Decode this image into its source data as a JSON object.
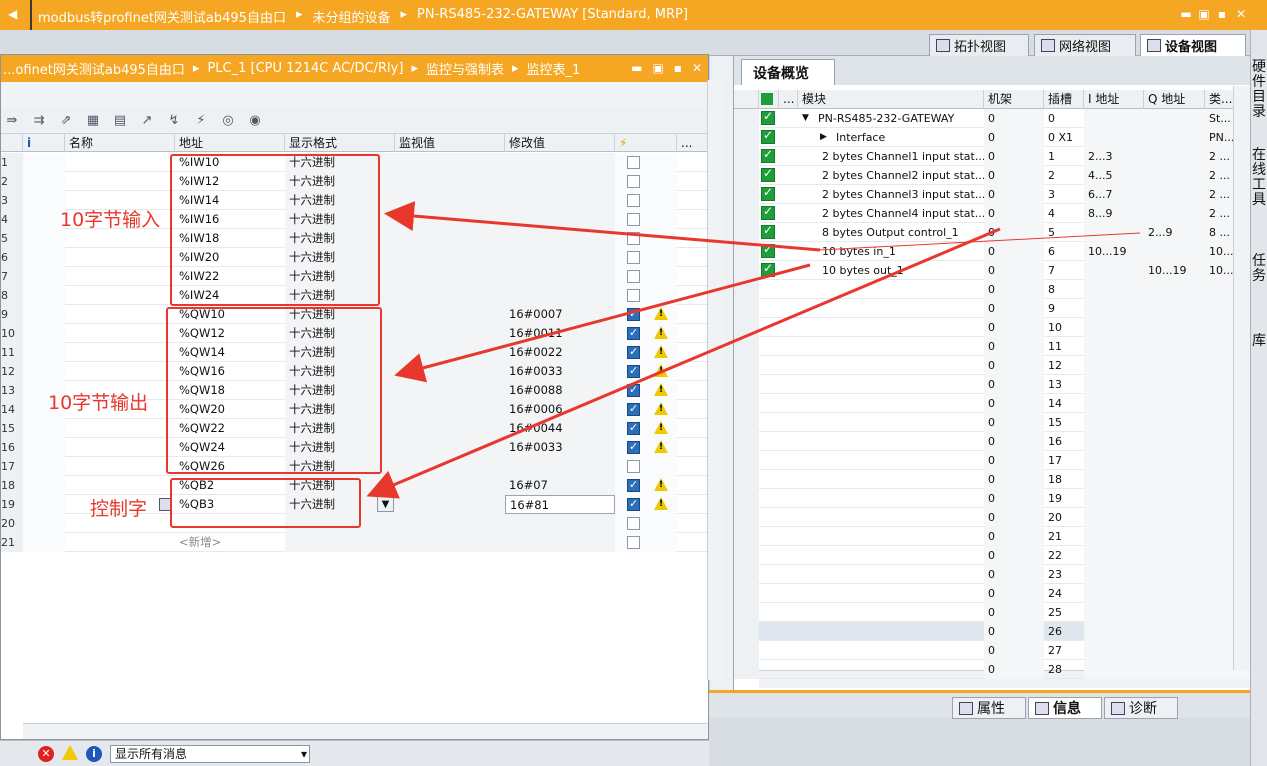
{
  "titlebar": {
    "crumbs": [
      "modbus转profinet网关测试ab495自由口",
      "未分组的设备",
      "PN-RS485-232-GATEWAY [Standard, MRP]"
    ],
    "controls": [
      "▬",
      "▣",
      "▪",
      "✕"
    ]
  },
  "view_tabs": [
    "拓扑视图",
    "网络视图",
    "设备视图"
  ],
  "left_panel": {
    "crumbs": [
      "...ofinet网关测试ab495自由口",
      "PLC_1 [CPU 1214C AC/DC/Rly]",
      "监控与强制表",
      "监控表_1"
    ],
    "controls": [
      "▬",
      "▣",
      "▪",
      "✕"
    ],
    "columns": [
      "i",
      "名称",
      "地址",
      "显示格式",
      "监视值",
      "修改值",
      "⚡",
      "..."
    ],
    "rows": [
      {
        "n": "1",
        "addr": "%IW10",
        "fmt": "十六进制",
        "mod": "",
        "check": false,
        "warn": false
      },
      {
        "n": "2",
        "addr": "%IW12",
        "fmt": "十六进制",
        "mod": "",
        "check": false,
        "warn": false
      },
      {
        "n": "3",
        "addr": "%IW14",
        "fmt": "十六进制",
        "mod": "",
        "check": false,
        "warn": false
      },
      {
        "n": "4",
        "addr": "%IW16",
        "fmt": "十六进制",
        "mod": "",
        "check": false,
        "warn": false
      },
      {
        "n": "5",
        "addr": "%IW18",
        "fmt": "十六进制",
        "mod": "",
        "check": false,
        "warn": false
      },
      {
        "n": "6",
        "addr": "%IW20",
        "fmt": "十六进制",
        "mod": "",
        "check": false,
        "warn": false
      },
      {
        "n": "7",
        "addr": "%IW22",
        "fmt": "十六进制",
        "mod": "",
        "check": false,
        "warn": false
      },
      {
        "n": "8",
        "addr": "%IW24",
        "fmt": "十六进制",
        "mod": "",
        "check": false,
        "warn": false
      },
      {
        "n": "9",
        "addr": "%QW10",
        "fmt": "十六进制",
        "mod": "16#0007",
        "check": true,
        "warn": true
      },
      {
        "n": "10",
        "addr": "%QW12",
        "fmt": "十六进制",
        "mod": "16#0011",
        "check": true,
        "warn": true
      },
      {
        "n": "11",
        "addr": "%QW14",
        "fmt": "十六进制",
        "mod": "16#0022",
        "check": true,
        "warn": true
      },
      {
        "n": "12",
        "addr": "%QW16",
        "fmt": "十六进制",
        "mod": "16#0033",
        "check": true,
        "warn": true
      },
      {
        "n": "13",
        "addr": "%QW18",
        "fmt": "十六进制",
        "mod": "16#0088",
        "check": true,
        "warn": true
      },
      {
        "n": "14",
        "addr": "%QW20",
        "fmt": "十六进制",
        "mod": "16#0006",
        "check": true,
        "warn": true
      },
      {
        "n": "15",
        "addr": "%QW22",
        "fmt": "十六进制",
        "mod": "16#0044",
        "check": true,
        "warn": true
      },
      {
        "n": "16",
        "addr": "%QW24",
        "fmt": "十六进制",
        "mod": "16#0033",
        "check": true,
        "warn": true
      },
      {
        "n": "17",
        "addr": "%QW26",
        "fmt": "十六进制",
        "mod": "",
        "check": false,
        "warn": false
      },
      {
        "n": "18",
        "addr": "%QB2",
        "fmt": "十六进制",
        "mod": "16#07",
        "check": true,
        "warn": true
      },
      {
        "n": "19",
        "addr": "%QB3",
        "fmt": "十六进制",
        "mod": "16#81",
        "check": true,
        "warn": true
      },
      {
        "n": "20",
        "addr": "",
        "fmt": "",
        "mod": "",
        "check": false,
        "warn": false
      },
      {
        "n": "21",
        "addr": "<新增>",
        "fmt": "",
        "mod": "",
        "check": false,
        "warn": false
      }
    ],
    "annotations": {
      "input": "10字节输入",
      "output": "10字节输出",
      "control": "控制字"
    }
  },
  "device_overview": {
    "tab": "设备概览",
    "columns": [
      "",
      "...",
      "模块",
      "机架",
      "插槽",
      "I 地址",
      "Q 地址",
      "类..."
    ],
    "rows": [
      {
        "name": "PN-RS485-232-GATEWAY",
        "rack": "0",
        "slot": "0",
        "i": "",
        "q": "",
        "type": "St...",
        "ok": true,
        "expand": "▼",
        "indent": 0
      },
      {
        "name": "Interface",
        "rack": "0",
        "slot": "0 X1",
        "i": "",
        "q": "",
        "type": "PN...",
        "ok": true,
        "expand": "▶",
        "indent": 1
      },
      {
        "name": "2 bytes Channel1 input stat...",
        "rack": "0",
        "slot": "1",
        "i": "2...3",
        "q": "",
        "type": "2 ...",
        "ok": true,
        "expand": "",
        "indent": 1
      },
      {
        "name": "2 bytes Channel2 input stat...",
        "rack": "0",
        "slot": "2",
        "i": "4...5",
        "q": "",
        "type": "2 ...",
        "ok": true,
        "expand": "",
        "indent": 1
      },
      {
        "name": "2 bytes Channel3 input stat...",
        "rack": "0",
        "slot": "3",
        "i": "6...7",
        "q": "",
        "type": "2 ...",
        "ok": true,
        "expand": "",
        "indent": 1
      },
      {
        "name": "2 bytes Channel4 input stat...",
        "rack": "0",
        "slot": "4",
        "i": "8...9",
        "q": "",
        "type": "2 ...",
        "ok": true,
        "expand": "",
        "indent": 1
      },
      {
        "name": "8 bytes Output control_1",
        "rack": "0",
        "slot": "5",
        "i": "",
        "q": "2...9",
        "type": "8 ...",
        "ok": true,
        "expand": "",
        "indent": 1
      },
      {
        "name": "10 bytes in_1",
        "rack": "0",
        "slot": "6",
        "i": "10...19",
        "q": "",
        "type": "10...",
        "ok": true,
        "expand": "",
        "indent": 1
      },
      {
        "name": "10 bytes out_1",
        "rack": "0",
        "slot": "7",
        "i": "",
        "q": "10...19",
        "type": "10...",
        "ok": true,
        "expand": "",
        "indent": 1
      },
      {
        "name": "",
        "rack": "0",
        "slot": "8",
        "i": "",
        "q": "",
        "type": "",
        "ok": false,
        "expand": "",
        "indent": 0
      },
      {
        "name": "",
        "rack": "0",
        "slot": "9",
        "i": "",
        "q": "",
        "type": "",
        "ok": false,
        "expand": "",
        "indent": 0
      },
      {
        "name": "",
        "rack": "0",
        "slot": "10",
        "i": "",
        "q": "",
        "type": "",
        "ok": false,
        "expand": "",
        "indent": 0
      },
      {
        "name": "",
        "rack": "0",
        "slot": "11",
        "i": "",
        "q": "",
        "type": "",
        "ok": false,
        "expand": "",
        "indent": 0
      },
      {
        "name": "",
        "rack": "0",
        "slot": "12",
        "i": "",
        "q": "",
        "type": "",
        "ok": false,
        "expand": "",
        "indent": 0
      },
      {
        "name": "",
        "rack": "0",
        "slot": "13",
        "i": "",
        "q": "",
        "type": "",
        "ok": false,
        "expand": "",
        "indent": 0
      },
      {
        "name": "",
        "rack": "0",
        "slot": "14",
        "i": "",
        "q": "",
        "type": "",
        "ok": false,
        "expand": "",
        "indent": 0
      },
      {
        "name": "",
        "rack": "0",
        "slot": "15",
        "i": "",
        "q": "",
        "type": "",
        "ok": false,
        "expand": "",
        "indent": 0
      },
      {
        "name": "",
        "rack": "0",
        "slot": "16",
        "i": "",
        "q": "",
        "type": "",
        "ok": false,
        "expand": "",
        "indent": 0
      },
      {
        "name": "",
        "rack": "0",
        "slot": "17",
        "i": "",
        "q": "",
        "type": "",
        "ok": false,
        "expand": "",
        "indent": 0
      },
      {
        "name": "",
        "rack": "0",
        "slot": "18",
        "i": "",
        "q": "",
        "type": "",
        "ok": false,
        "expand": "",
        "indent": 0
      },
      {
        "name": "",
        "rack": "0",
        "slot": "19",
        "i": "",
        "q": "",
        "type": "",
        "ok": false,
        "expand": "",
        "indent": 0
      },
      {
        "name": "",
        "rack": "0",
        "slot": "20",
        "i": "",
        "q": "",
        "type": "",
        "ok": false,
        "expand": "",
        "indent": 0
      },
      {
        "name": "",
        "rack": "0",
        "slot": "21",
        "i": "",
        "q": "",
        "type": "",
        "ok": false,
        "expand": "",
        "indent": 0
      },
      {
        "name": "",
        "rack": "0",
        "slot": "22",
        "i": "",
        "q": "",
        "type": "",
        "ok": false,
        "expand": "",
        "indent": 0
      },
      {
        "name": "",
        "rack": "0",
        "slot": "23",
        "i": "",
        "q": "",
        "type": "",
        "ok": false,
        "expand": "",
        "indent": 0
      },
      {
        "name": "",
        "rack": "0",
        "slot": "24",
        "i": "",
        "q": "",
        "type": "",
        "ok": false,
        "expand": "",
        "indent": 0
      },
      {
        "name": "",
        "rack": "0",
        "slot": "25",
        "i": "",
        "q": "",
        "type": "",
        "ok": false,
        "expand": "",
        "indent": 0
      },
      {
        "name": "",
        "rack": "0",
        "slot": "26",
        "i": "",
        "q": "",
        "type": "",
        "ok": false,
        "expand": "",
        "indent": 0
      },
      {
        "name": "",
        "rack": "0",
        "slot": "27",
        "i": "",
        "q": "",
        "type": "",
        "ok": false,
        "expand": "",
        "indent": 0
      },
      {
        "name": "",
        "rack": "0",
        "slot": "28",
        "i": "",
        "q": "",
        "type": "",
        "ok": false,
        "expand": "",
        "indent": 0
      }
    ]
  },
  "right_sidebar": [
    "硬件目录",
    "在线工具",
    "任务",
    "库"
  ],
  "bottom_tabs": [
    "属性",
    "信息",
    "诊断"
  ],
  "message_filter": "显示所有消息"
}
